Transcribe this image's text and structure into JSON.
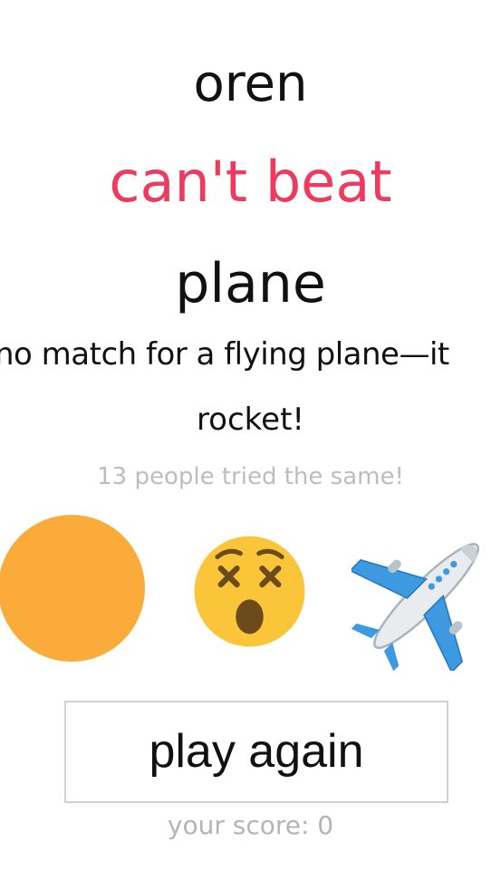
{
  "result": {
    "player_word": "oren",
    "verdict": "can't beat",
    "opponent_word": "plane",
    "reason_line1": "no match for a flying plane—it",
    "reason_line2": "rocket!",
    "tried_count_text": "13 people tried the same!"
  },
  "emojis": {
    "player_icon": "orange-circle",
    "outcome_icon": "dizzy-face",
    "opponent_icon": "airplane"
  },
  "actions": {
    "play_again_label": "play again"
  },
  "score": {
    "text": "your score: 0"
  },
  "colors": {
    "verdict": "#ee3a5e",
    "muted_text": "#bdbdbd",
    "player_circle": "#fbab3a",
    "emoji_face": "#fbc53a"
  }
}
